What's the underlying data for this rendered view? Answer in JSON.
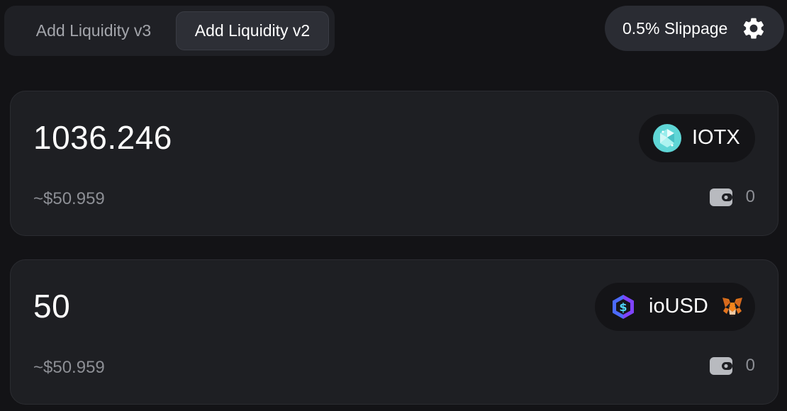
{
  "tabs": {
    "v3_label": "Add Liquidity v3",
    "v2_label": "Add Liquidity v2",
    "active": "v2"
  },
  "slippage": {
    "label": "0.5% Slippage",
    "icon": "gear-icon"
  },
  "inputs": [
    {
      "amount": "1036.246",
      "usd_value": "~$50.959",
      "token": "IOTX",
      "token_icon": "iotx-icon",
      "balance": "0",
      "balance_icon": "wallet-icon"
    },
    {
      "amount": "50",
      "usd_value": "~$50.959",
      "token": "ioUSD",
      "token_icon": "iousd-icon",
      "extra_icon": "metamask-fox-icon",
      "balance": "0",
      "balance_icon": "wallet-icon"
    }
  ],
  "colors": {
    "background": "#131316",
    "card": "#1e1f23",
    "pill": "#141417",
    "muted_text": "#8d8f95",
    "iotx_accent": "#5fd6d6",
    "iousd_accent": "#6a4cff"
  }
}
